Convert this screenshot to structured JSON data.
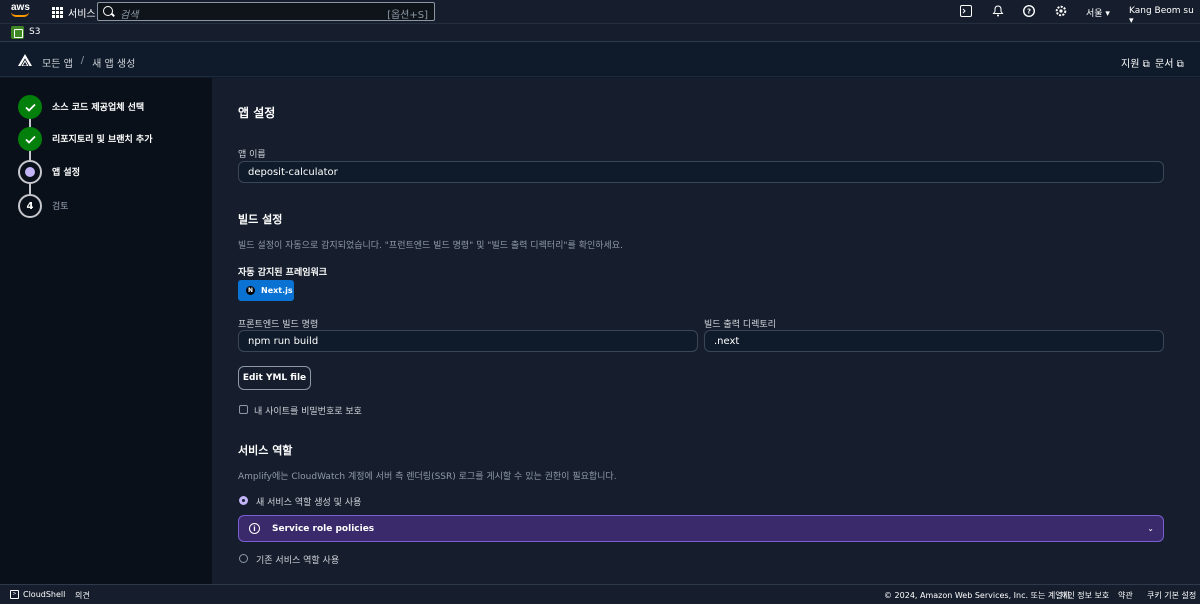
{
  "topnav": {
    "logo_text": "aws",
    "services_label": "서비스",
    "search_placeholder": "검색",
    "search_shortcut": "[옵션+S]",
    "region": "서울 ▾",
    "user": "Kang Beom su ▾",
    "icons": [
      "cloudshell-icon",
      "bell-icon",
      "help-icon",
      "gear-icon"
    ]
  },
  "favorites": {
    "s3_label": "S3"
  },
  "header": {
    "breadcrumb_all": "모든 앱",
    "breadcrumb_sep": "/",
    "breadcrumb_current": "새 앱 생성",
    "support_link": "지원",
    "docs_link": "문서"
  },
  "steps": [
    {
      "label": "소스 코드 제공업체 선택",
      "state": "done"
    },
    {
      "label": "리포지토리 및 브랜치 추가",
      "state": "done"
    },
    {
      "label": "앱 설정",
      "state": "current"
    },
    {
      "label": "검토",
      "state": "todo",
      "number": "4"
    }
  ],
  "main": {
    "title": "앱 설정",
    "app_name_label": "앱 이름",
    "app_name_value": "deposit-calculator",
    "build_title": "빌드 설정",
    "build_desc": "빌드 설정이 자동으로 감지되었습니다. \"프런트엔드 빌드 명령\" 및 \"빌드 출력 디렉터리\"를 확인하세요.",
    "framework_label": "자동 감지된 프레임워크",
    "framework_value": "Next.js",
    "build_cmd_label": "프론트엔드 빌드 명령",
    "build_cmd_value": "npm run build",
    "output_dir_label": "빌드 출력 디렉토리",
    "output_dir_value": ".next",
    "edit_yml_button": "Edit YML file",
    "password_protect_label": "내 사이트를 비밀번호로 보호",
    "service_role_title": "서비스 역할",
    "service_role_desc": "Amplify에는 CloudWatch 계정에 서버 측 렌더링(SSR) 로그를 게시할 수 있는 권한이 필요합니다.",
    "new_role_label": "새 서비스 역할 생성 및 사용",
    "policy_label": "Service role policies",
    "existing_role_label": "기존 서비스 역할 사용"
  },
  "footer": {
    "cloudshell": "CloudShell",
    "feedback": "의견",
    "copyright": "© 2024, Amazon Web Services, Inc. 또는 계열사.",
    "privacy": "개인 정보 보호",
    "terms": "약관",
    "cookies": "쿠키 기본 설정"
  },
  "colors": {
    "accent_done": "#037f0c",
    "accent_current": "#c3b3f7",
    "framework_badge": "#0972d3",
    "policy_bar": "#3b2a6b"
  }
}
